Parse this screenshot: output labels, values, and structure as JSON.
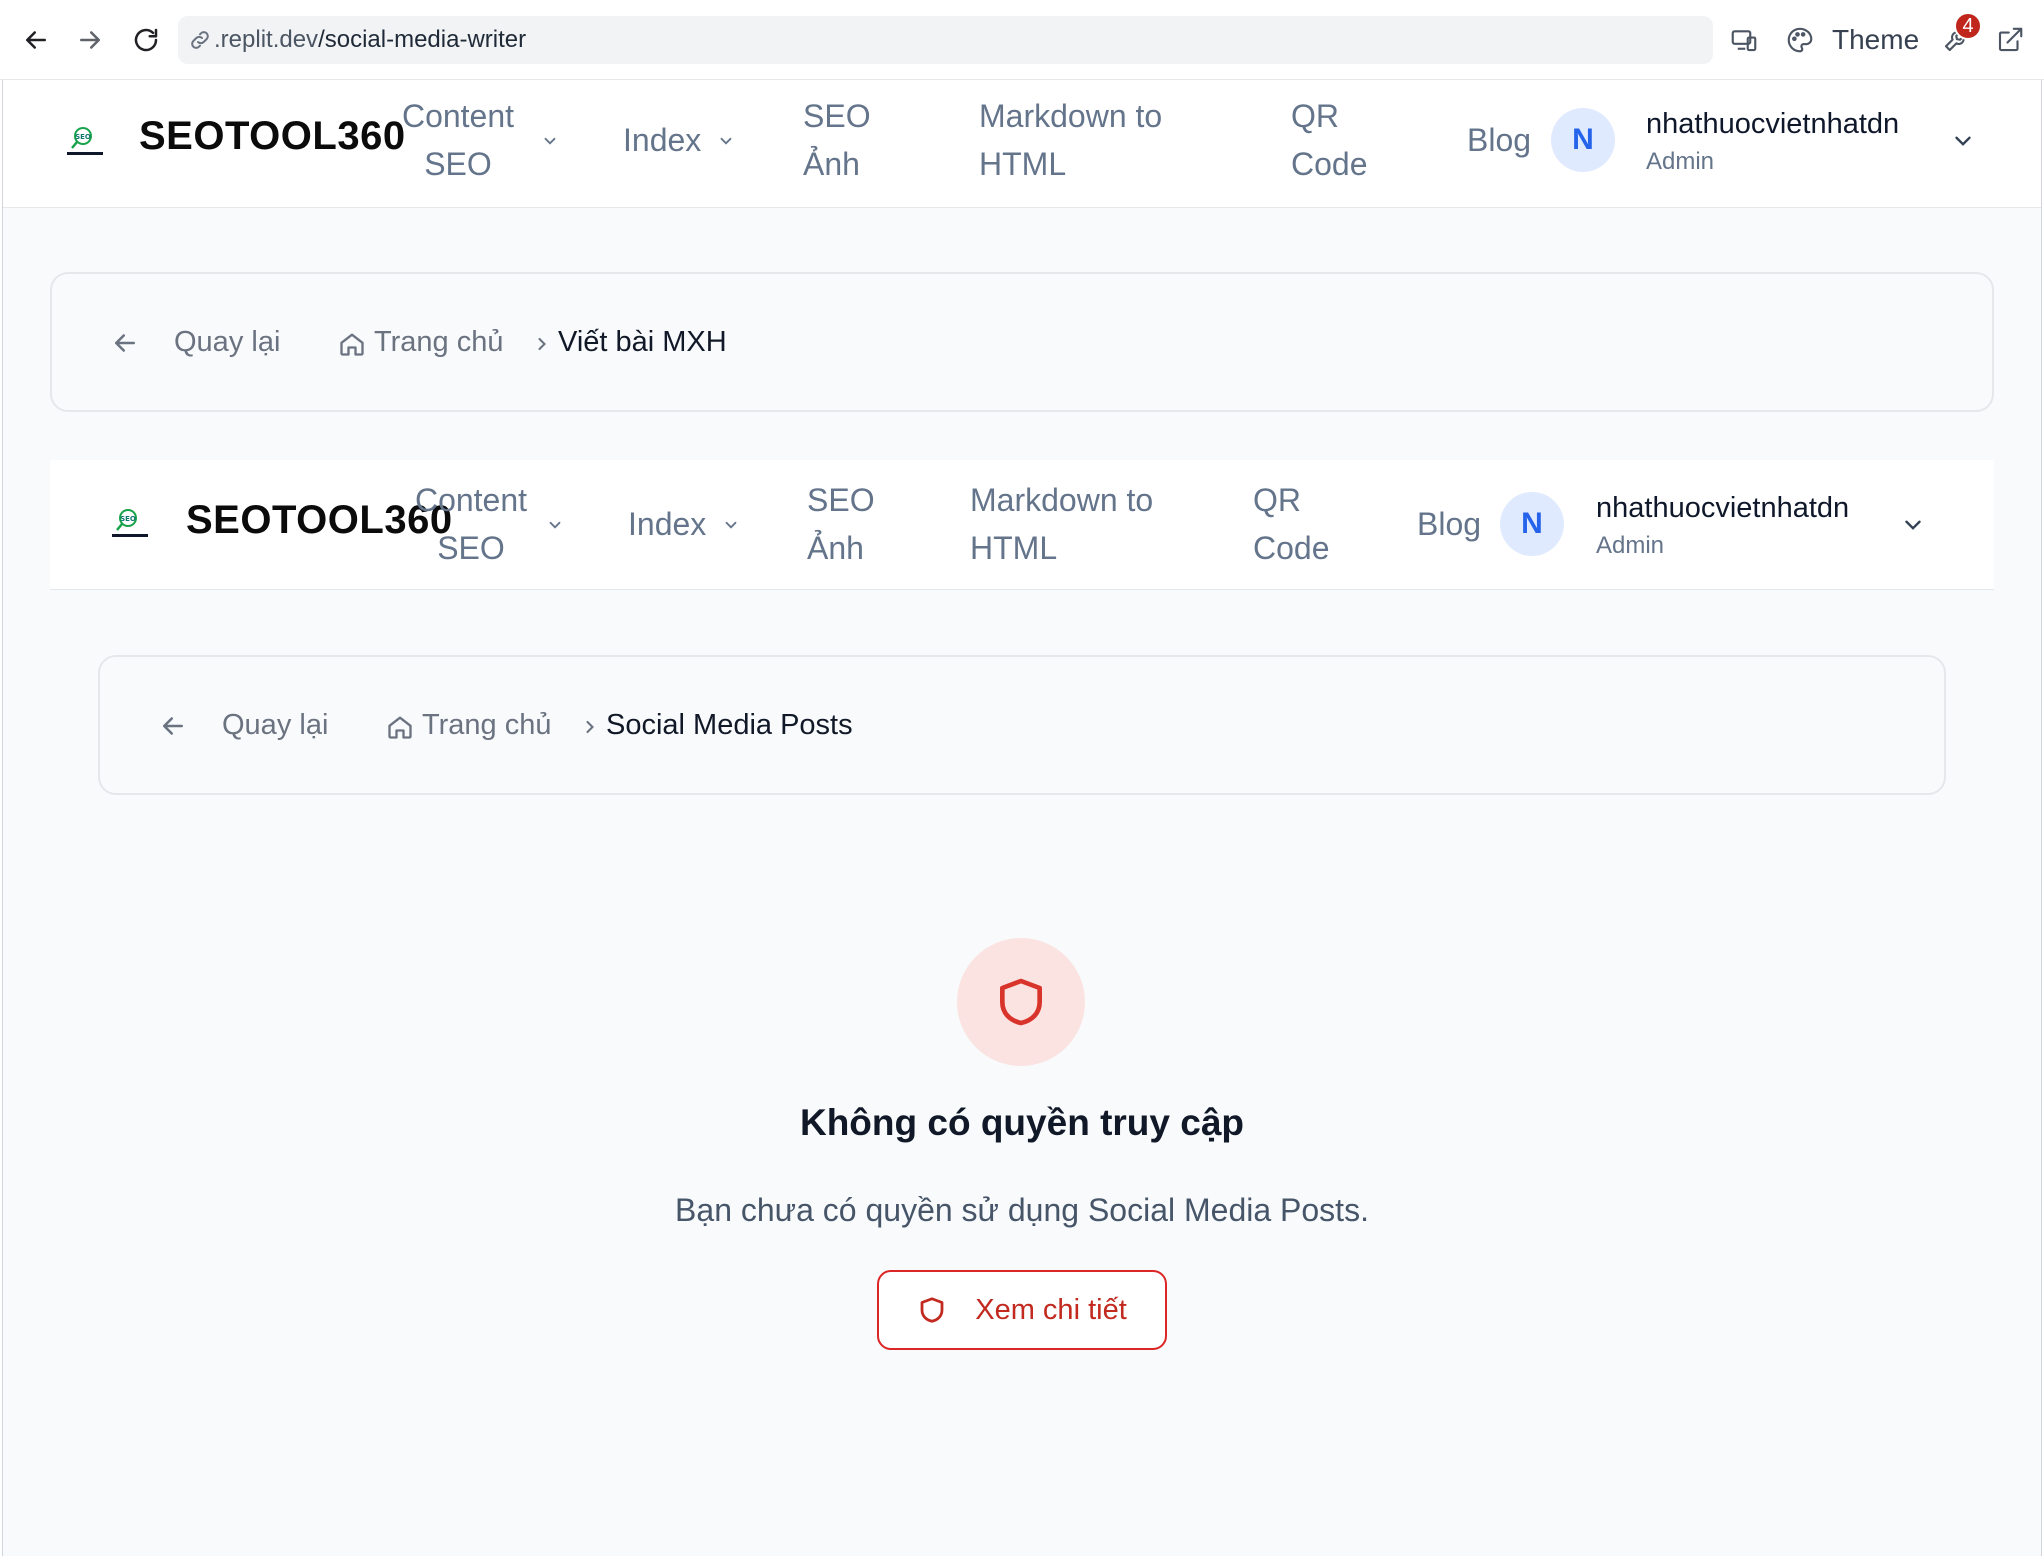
{
  "browser": {
    "url_prefix": ".replit.dev",
    "url_path": "/social-media-writer",
    "theme_label": "Theme",
    "notification_count": "4"
  },
  "outer_nav": {
    "brand": "SEOTOOL360",
    "items": [
      "Content SEO",
      "Index",
      "SEO Ảnh",
      "Markdown to HTML",
      "QR Code",
      "Blog"
    ],
    "avatar_initial": "N",
    "user_name": "nhathuocvietnhatdn",
    "user_role": "Admin"
  },
  "outer_breadcrumb": {
    "back_label": "Quay lại",
    "home_label": "Trang chủ",
    "current": "Viết bài MXH"
  },
  "inner_nav": {
    "brand": "SEOTOOL360",
    "items": [
      "Content SEO",
      "Index",
      "SEO Ảnh",
      "Markdown to HTML",
      "QR Code",
      "Blog"
    ],
    "avatar_initial": "N",
    "user_name": "nhathuocvietnhatdn",
    "user_role": "Admin"
  },
  "inner_breadcrumb": {
    "back_label": "Quay lại",
    "home_label": "Trang chủ",
    "current": "Social Media Posts"
  },
  "access_denied": {
    "title": "Không có quyền truy cập",
    "message": "Bạn chưa có quyền sử dụng Social Media Posts.",
    "button_label": "Xem chi tiết"
  },
  "colors": {
    "accent_red": "#dc2626",
    "avatar_blue": "#2563eb",
    "page_bg": "#f8fafc"
  }
}
